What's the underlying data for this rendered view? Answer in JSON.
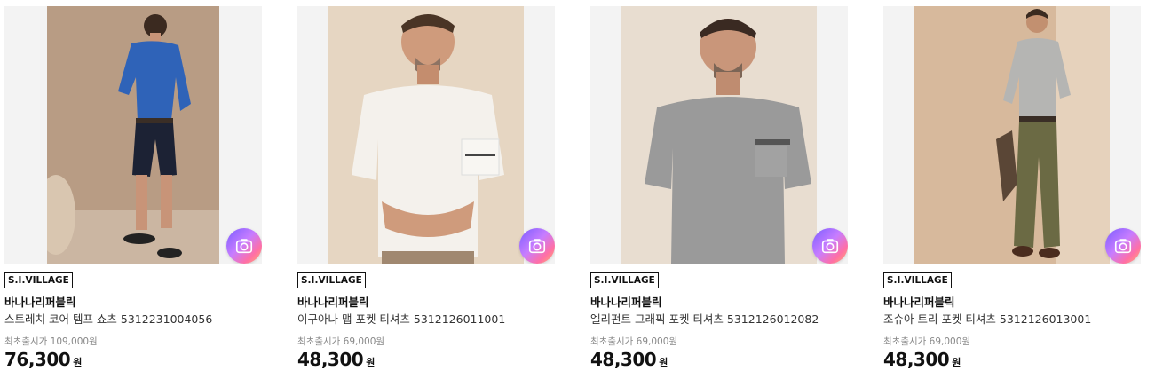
{
  "products": [
    {
      "badge": "S.I.VILLAGE",
      "brand": "바나나리퍼블릭",
      "name": "스트레치 코어 템프 쇼츠 5312231004056",
      "original_price": "최초출시가 109,000원",
      "price": "76,300",
      "currency": "원",
      "image_icon": "man-blue-sweater-shorts-photo"
    },
    {
      "badge": "S.I.VILLAGE",
      "brand": "바나나리퍼블릭",
      "name": "이구아나 맵 포켓 티셔츠 5312126011001",
      "original_price": "최초출시가 69,000원",
      "price": "48,300",
      "currency": "원",
      "image_icon": "man-white-pocket-tee-photo"
    },
    {
      "badge": "S.I.VILLAGE",
      "brand": "바나나리퍼블릭",
      "name": "엘리펀트 그래픽 포켓 티셔츠 5312126012082",
      "original_price": "최초출시가 69,000원",
      "price": "48,300",
      "currency": "원",
      "image_icon": "man-gray-pocket-tee-photo"
    },
    {
      "badge": "S.I.VILLAGE",
      "brand": "바나나리퍼블릭",
      "name": "조슈아 트리 포켓 티셔츠 5312126013001",
      "original_price": "최초출시가 69,000원",
      "price": "48,300",
      "currency": "원",
      "image_icon": "man-gray-tee-olive-pants-photo"
    }
  ],
  "image_search_icon": "camera-search-icon"
}
